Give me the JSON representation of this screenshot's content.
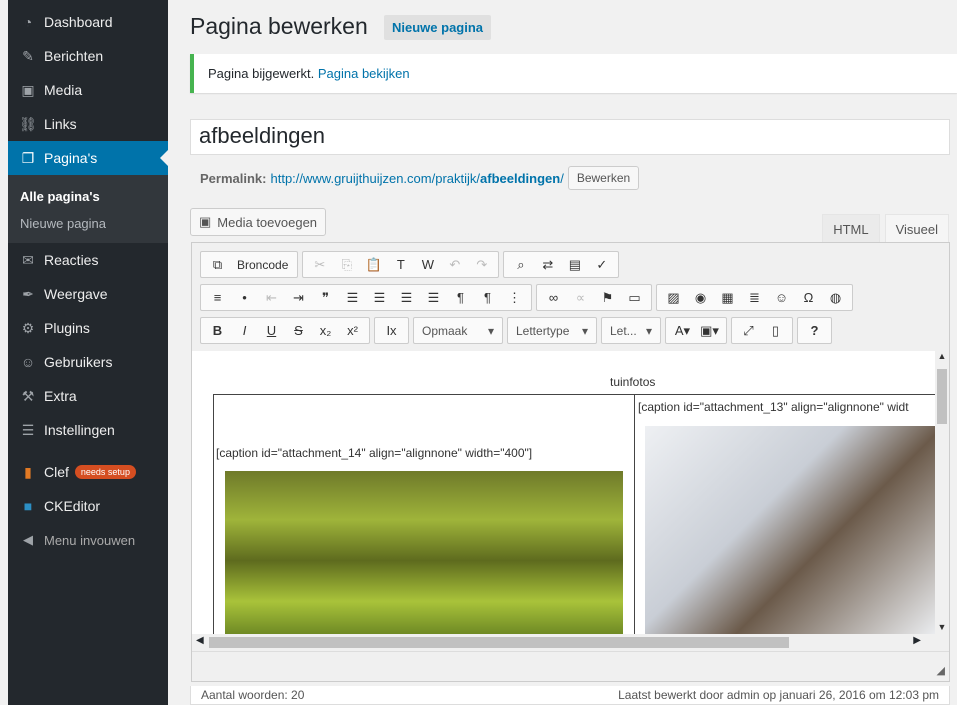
{
  "sidebar": {
    "items": [
      {
        "label": "Dashboard",
        "icon": "dashboard-icon",
        "glyph": "◔"
      },
      {
        "label": "Berichten",
        "icon": "pin-icon",
        "glyph": "✎"
      },
      {
        "label": "Media",
        "icon": "media-icon",
        "glyph": "▣"
      },
      {
        "label": "Links",
        "icon": "link-icon",
        "glyph": "⛓"
      },
      {
        "label": "Pagina's",
        "icon": "pages-icon",
        "glyph": "❐"
      }
    ],
    "submenu": [
      "Alle pagina's",
      "Nieuwe pagina"
    ],
    "items2": [
      {
        "label": "Reacties",
        "icon": "comments-icon",
        "glyph": "✉"
      },
      {
        "label": "Weergave",
        "icon": "appearance-icon",
        "glyph": "✒"
      },
      {
        "label": "Plugins",
        "icon": "plugins-icon",
        "glyph": "⚙"
      },
      {
        "label": "Gebruikers",
        "icon": "users-icon",
        "glyph": "☺"
      },
      {
        "label": "Extra",
        "icon": "tools-icon",
        "glyph": "⚒"
      },
      {
        "label": "Instellingen",
        "icon": "settings-icon",
        "glyph": "☰"
      }
    ],
    "clef": {
      "label": "Clef",
      "badge": "needs setup"
    },
    "ckeditor": "CKEditor",
    "collapse": "Menu invouwen"
  },
  "header": {
    "title": "Pagina bewerken",
    "add_new": "Nieuwe pagina"
  },
  "notice": {
    "text": "Pagina bijgewerkt.",
    "link": "Pagina bekijken"
  },
  "post": {
    "title": "afbeeldingen"
  },
  "permalink": {
    "label": "Permalink:",
    "url_base": "http://www.gruijthuijzen.com/praktijk/",
    "slug": "afbeeldingen",
    "suffix": "/",
    "edit": "Bewerken"
  },
  "media_button": "Media toevoegen",
  "tabs": [
    "HTML",
    "Visueel"
  ],
  "toolbar": {
    "source": "Broncode",
    "format": "Opmaak",
    "font": "Lettertype",
    "size": "Let..."
  },
  "content": {
    "heading": "tuinfotos",
    "caption1": "[caption id=\"attachment_14\" align=\"alignnone\" width=\"400\"]",
    "caption2": "[caption id=\"attachment_13\" align=\"alignnone\" widt"
  },
  "footer": {
    "words": "Aantal woorden: 20",
    "edited": "Laatst bewerkt door admin op januari 26, 2016 om 12:03 pm"
  }
}
